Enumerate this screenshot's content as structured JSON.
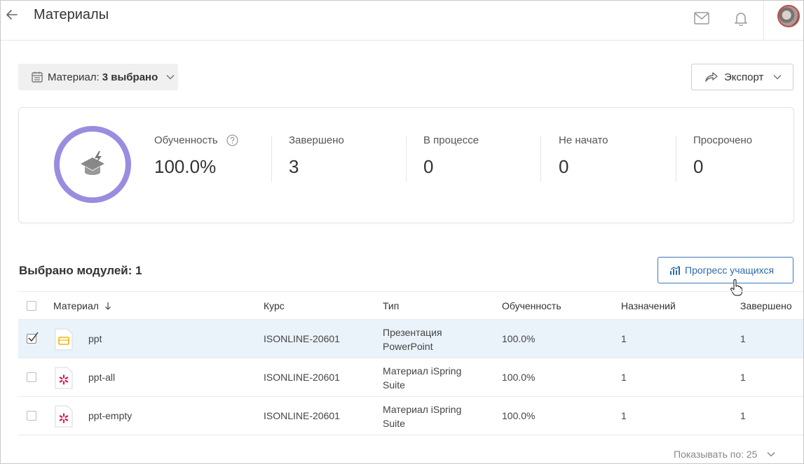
{
  "header": {
    "title": "Материалы"
  },
  "filter": {
    "prefix": "Материал:",
    "value": "3 выбрано"
  },
  "export": {
    "label": "Экспорт"
  },
  "stats": {
    "progress_fraction": 1.0,
    "accent_color": "#9b8ce0",
    "items": [
      {
        "label": "Обученность",
        "value": "100.0%"
      },
      {
        "label": "Завершено",
        "value": "3"
      },
      {
        "label": "В процессе",
        "value": "0"
      },
      {
        "label": "Не начато",
        "value": "0"
      },
      {
        "label": "Просрочено",
        "value": "0"
      }
    ]
  },
  "section": {
    "title": "Выбрано модулей: 1",
    "progress_button": "Прогресс учащихся"
  },
  "table": {
    "columns": [
      "Материал",
      "Курс",
      "Тип",
      "Обученность",
      "Назначений",
      "Завершено"
    ],
    "rows": [
      {
        "name": "ppt",
        "course": "ISONLINE-20601",
        "type1": "Презентация",
        "type2": "PowerPoint",
        "completion": "100.0%",
        "assigned": "1",
        "completed": "1",
        "checked": true,
        "icon": "presentation-icon"
      },
      {
        "name": "ppt-all",
        "course": "ISONLINE-20601",
        "type1": "Материал iSpring",
        "type2": "Suite",
        "completion": "100.0%",
        "assigned": "1",
        "completed": "1",
        "checked": false,
        "icon": "ispring-icon"
      },
      {
        "name": "ppt-empty",
        "course": "ISONLINE-20601",
        "type1": "Материал iSpring",
        "type2": "Suite",
        "completion": "100.0%",
        "assigned": "1",
        "completed": "1",
        "checked": false,
        "icon": "ispring-icon"
      }
    ]
  },
  "pager": {
    "label": "Показывать по: 25"
  }
}
